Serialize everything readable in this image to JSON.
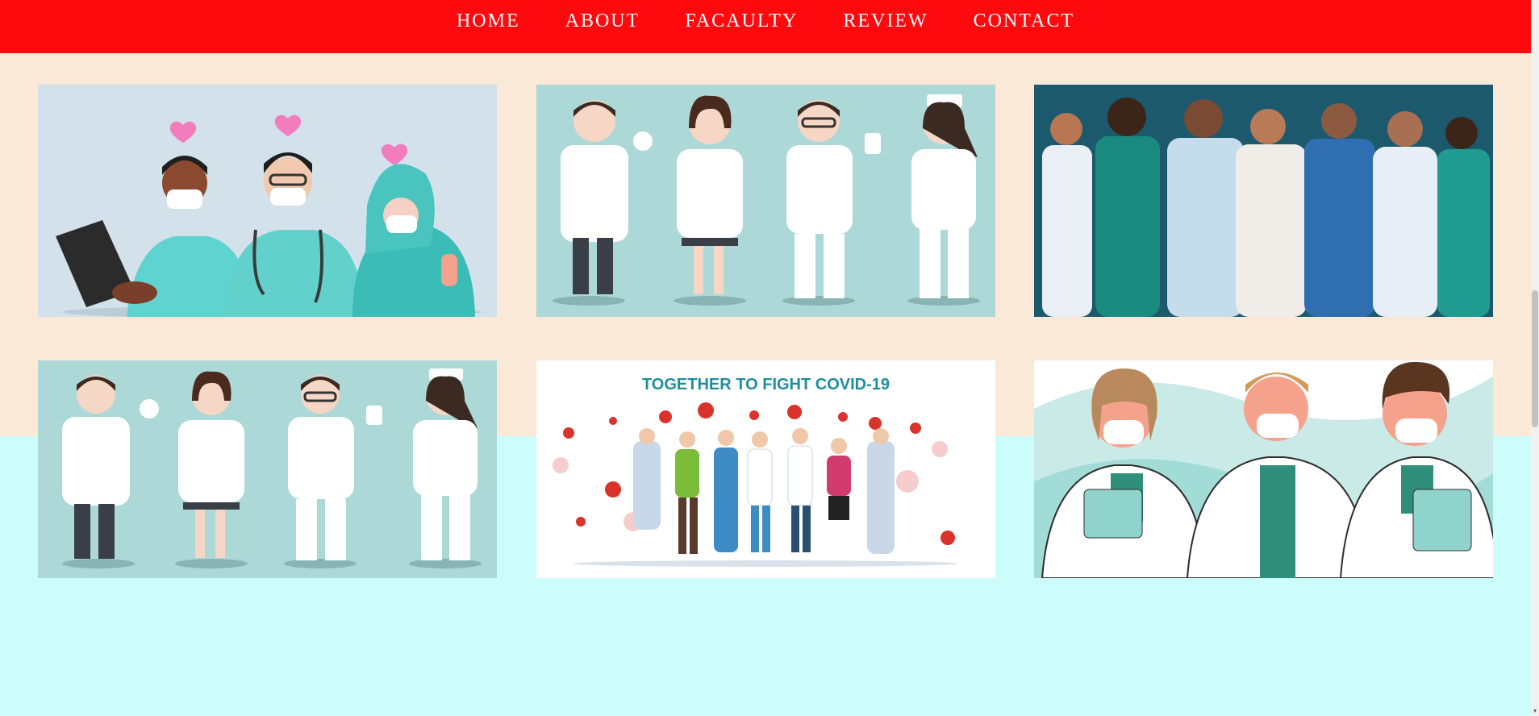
{
  "nav": {
    "items": [
      {
        "label": "HOME"
      },
      {
        "label": "ABOUT"
      },
      {
        "label": "FACAULTY"
      },
      {
        "label": "REVIEW"
      },
      {
        "label": "CONTACT"
      }
    ]
  },
  "gallery": {
    "images": [
      {
        "icon": "masked-doctors-hearts-illustration"
      },
      {
        "icon": "four-medical-staff-illustration"
      },
      {
        "icon": "diverse-healthcare-team-illustration"
      },
      {
        "icon": "four-medical-staff-illustration"
      },
      {
        "icon": "covid-frontline-workers-illustration",
        "caption": "TOGETHER TO FIGHT COVID-19"
      },
      {
        "icon": "three-masked-doctors-illustration"
      }
    ]
  },
  "colors": {
    "navbar": "#fe0a0e",
    "top_section": "#fae9d7",
    "bottom_section": "#ccfdfb",
    "nav_text": "#ffffff"
  }
}
